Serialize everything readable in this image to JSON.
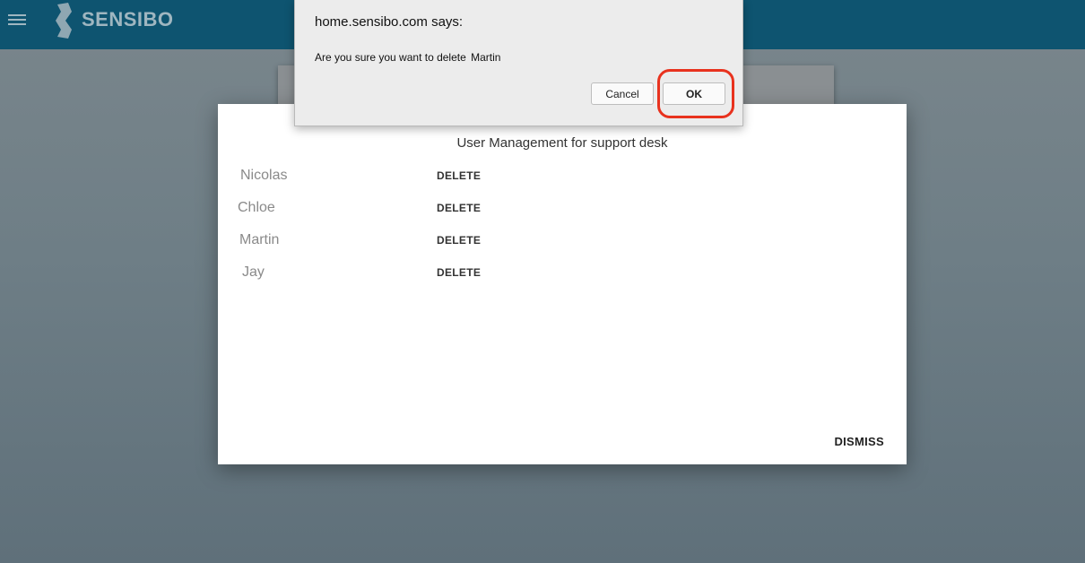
{
  "header": {
    "brand": "SENSIBO",
    "menu_icon": "hamburger-menu-icon",
    "logo_icon": "sensibo-logo-icon",
    "color": "#0e5470"
  },
  "modal": {
    "title": "User Management for support desk",
    "users": [
      {
        "name": "Nicolas",
        "action": "DELETE"
      },
      {
        "name": "Chloe",
        "action": "DELETE"
      },
      {
        "name": "Martin",
        "action": "DELETE"
      },
      {
        "name": "Jay",
        "action": "DELETE"
      }
    ],
    "dismiss_label": "DISMISS"
  },
  "alert": {
    "title": "home.sensibo.com says:",
    "message": "Are you sure you want to delete",
    "target_name": "Martin",
    "cancel_label": "Cancel",
    "ok_label": "OK",
    "highlight_color": "#e8321e"
  }
}
